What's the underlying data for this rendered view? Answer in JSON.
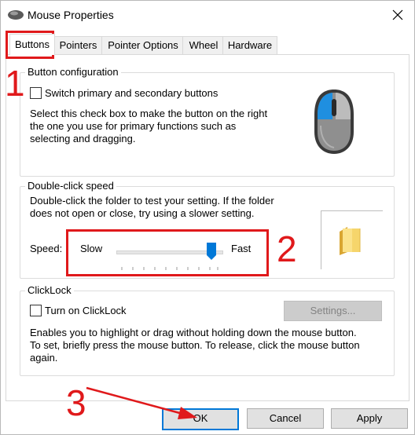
{
  "window": {
    "title": "Mouse Properties"
  },
  "icons": {
    "app": "mouse-icon",
    "close": "close-icon",
    "folder": "folder-icon",
    "mouse_illustration": "mouse-illustration-icon",
    "slider_thumb": "slider-thumb-icon"
  },
  "tabs": [
    {
      "label": "Buttons",
      "active": true
    },
    {
      "label": "Pointers"
    },
    {
      "label": "Pointer Options"
    },
    {
      "label": "Wheel"
    },
    {
      "label": "Hardware"
    }
  ],
  "button_config": {
    "legend": "Button configuration",
    "checkbox_label": "Switch primary and secondary buttons",
    "checked": false,
    "desc_lines": [
      "Select this check box to make the button on the right",
      "the one you use for primary functions such as",
      "selecting and dragging."
    ]
  },
  "double_click": {
    "legend": "Double-click speed",
    "desc_lines": [
      "Double-click the folder to test your setting. If the folder",
      "does not open or close, try using a slower setting."
    ],
    "speed_label": "Speed:",
    "slow_label": "Slow",
    "fast_label": "Fast",
    "slider_value": 0.9
  },
  "clicklock": {
    "legend": "ClickLock",
    "checkbox_label": "Turn on ClickLock",
    "checked": false,
    "settings_button": "Settings...",
    "desc_lines": [
      "Enables you to highlight or drag without holding down the mouse button.",
      "To set, briefly press the mouse button. To release, click the mouse button",
      "again."
    ]
  },
  "footer": {
    "ok": "OK",
    "cancel": "Cancel",
    "apply": "Apply"
  },
  "annotations": {
    "step1": "1",
    "step2": "2",
    "step3": "3"
  },
  "colors": {
    "accent": "#0078d7",
    "annotation_red": "#e0191b"
  }
}
